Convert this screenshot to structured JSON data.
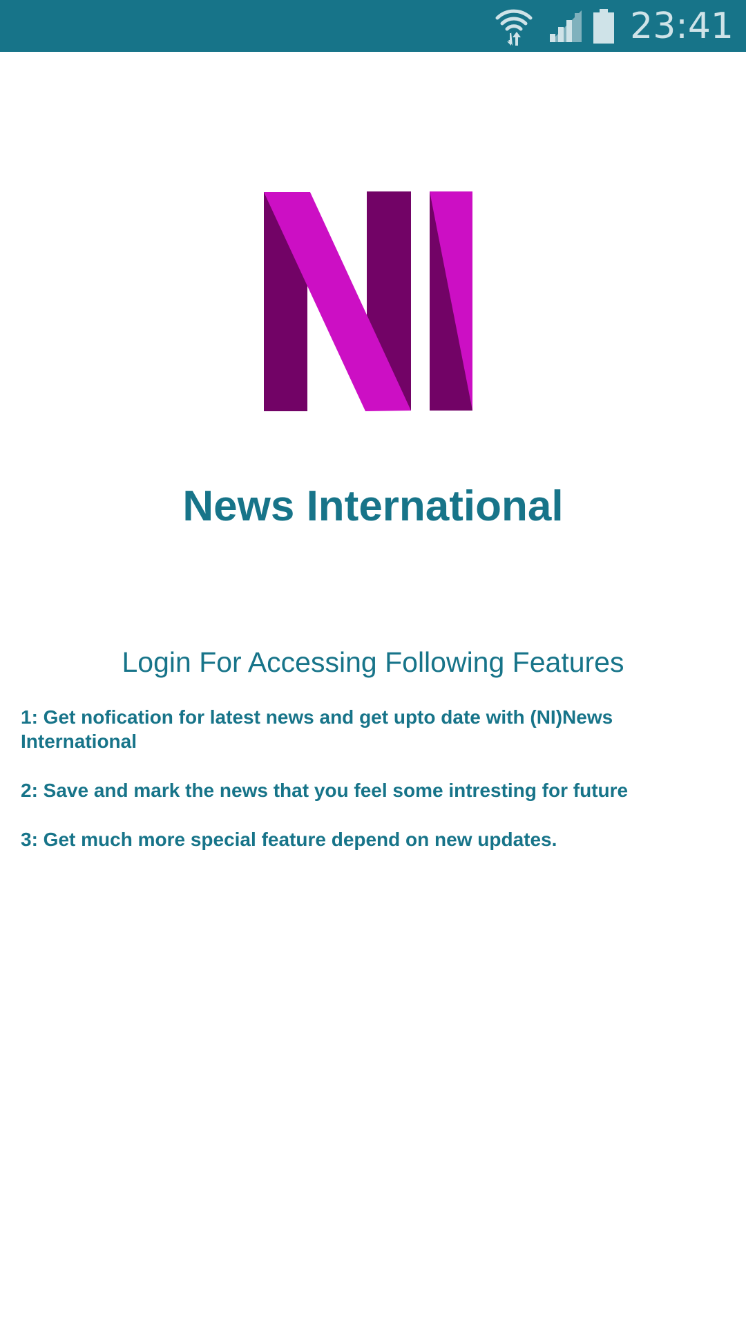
{
  "status_bar": {
    "time": "23:41",
    "icons": [
      "wifi-icon",
      "cellular-signal-icon",
      "battery-icon"
    ],
    "background": "#177489"
  },
  "logo": {
    "letters": "NI",
    "colors": {
      "dark": "#720366",
      "bright": "#cc0fc4"
    }
  },
  "app_title": "News International",
  "login_heading": "Login For Accessing Following Features",
  "features": [
    "1: Get nofication for latest news and get upto date with (NI)News International",
    "2: Save and mark the news that you feel some intresting for future",
    "3: Get much more special feature depend on new updates."
  ],
  "text_color": "#177489"
}
